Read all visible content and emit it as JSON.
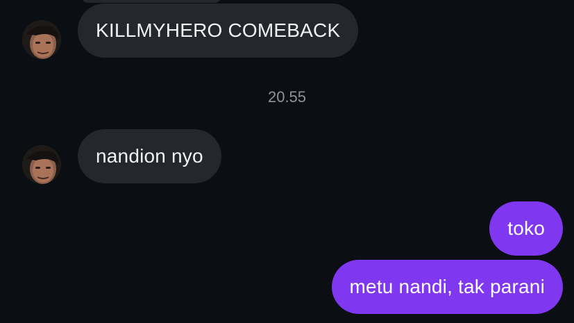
{
  "colors": {
    "background": "#0b0f13",
    "incoming_bubble": "#24282d",
    "outgoing_bubble": "#8037f0",
    "timestamp_text": "#8e939a"
  },
  "messages": [
    {
      "direction": "incoming",
      "text": "KILLMYHERO COMEBACK",
      "avatar": "sender-avatar"
    },
    {
      "direction": "incoming",
      "text": "nandion nyo",
      "avatar": "sender-avatar"
    },
    {
      "direction": "outgoing",
      "text": "toko"
    },
    {
      "direction": "outgoing",
      "text": "metu nandi, tak parani"
    }
  ],
  "timestamp": "20.55"
}
